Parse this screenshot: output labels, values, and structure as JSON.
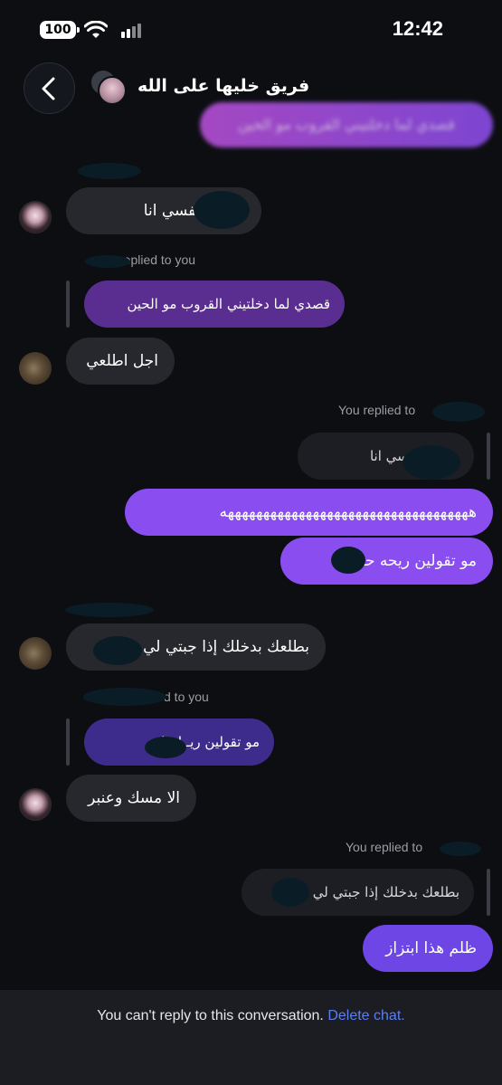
{
  "status_bar": {
    "battery": "100",
    "time": "12:42"
  },
  "header": {
    "title": "فريق خليها على الله"
  },
  "messages": {
    "top_partial": "قصدي لما دخلتيني القروب مو الحين",
    "m1": "وساده نفسي انا",
    "reply_label_1": "replied to you",
    "quote_1": "قصدي لما دخلتيني القروب مو الحين",
    "m2": "اجل اطلعي",
    "reply_label_2": "You replied to",
    "quote_2": "وساده نفسي انا",
    "m3": "هههههههههههههههههههههههههههههههههههه",
    "m4": "مو تقولين ريحه  حلوه",
    "m5": "بطلعك بدخلك إذا جبتي  لي",
    "reply_label_3": "d to you",
    "quote_3": "مو تقولين ريـ  ا حلوه",
    "m6": "الا مسك وعنبر",
    "reply_label_4": "You replied to",
    "quote_4": "بطلعك بدخلك إذا جبتي  لي",
    "m7": "ظلم هذا ابتزاز"
  },
  "footer": {
    "notice": "You can't reply to this conversation.",
    "action": "Delete chat."
  },
  "colors": {
    "outgoing": "#8a4ef0",
    "incoming": "#26282e",
    "link": "#5b7ff0"
  }
}
